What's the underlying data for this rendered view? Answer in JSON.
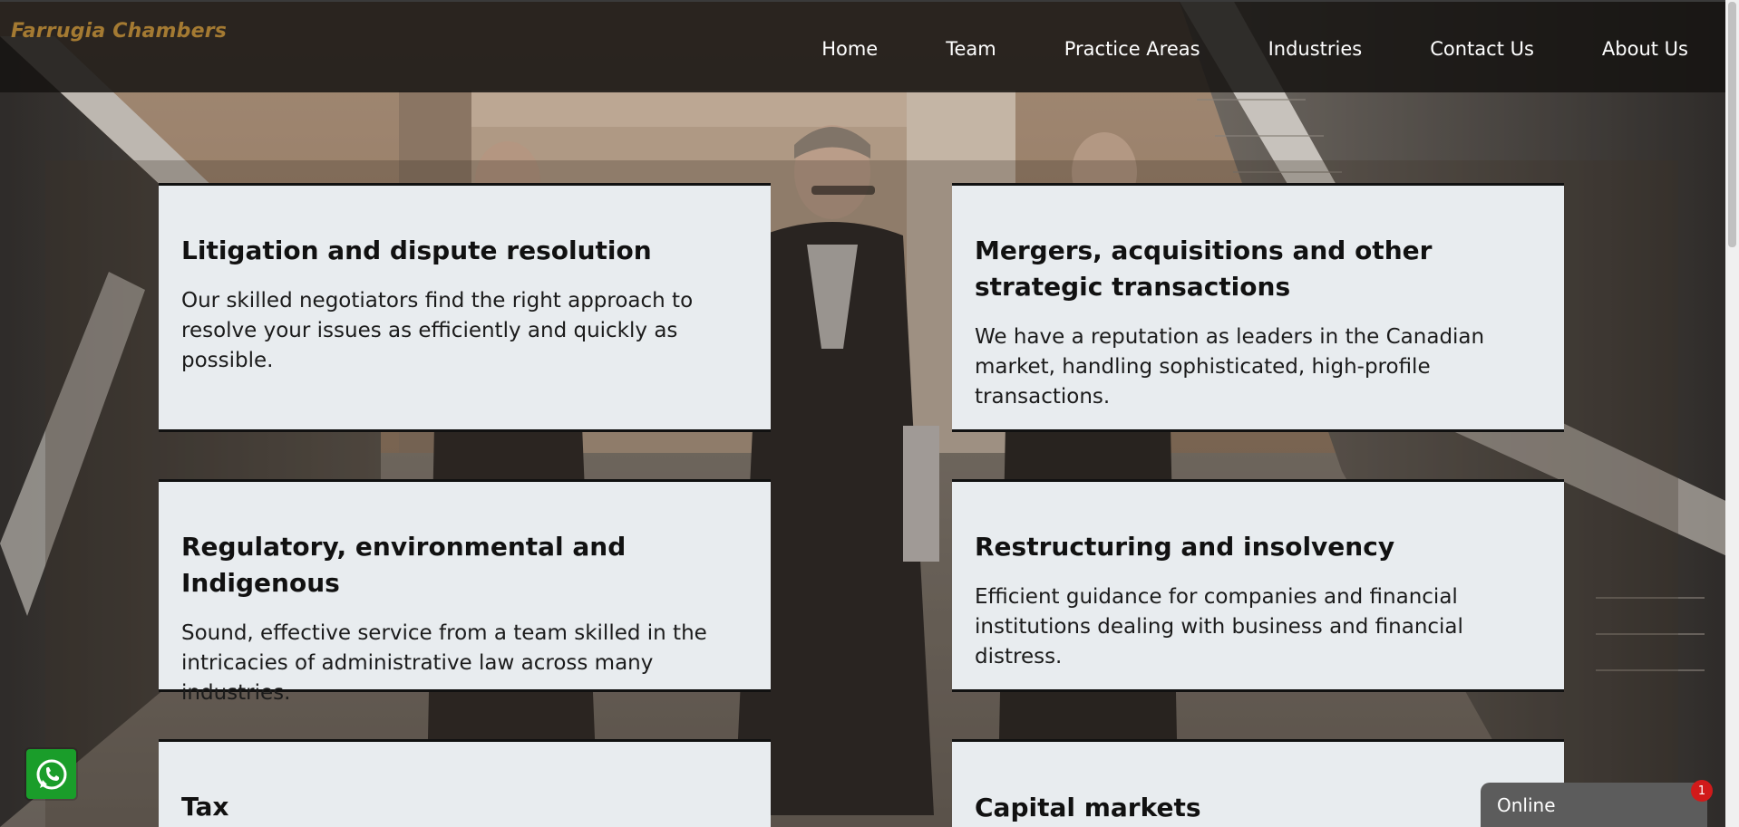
{
  "header": {
    "logo": "Farrugia Chambers",
    "nav": [
      {
        "label": "Home"
      },
      {
        "label": "Team"
      },
      {
        "label": "Practice Areas"
      },
      {
        "label": "Industries"
      },
      {
        "label": "Contact Us"
      },
      {
        "label": "About Us"
      }
    ]
  },
  "practice_areas": [
    {
      "title": "Litigation and dispute resolution",
      "description": "Our skilled negotiators find the right approach to resolve your issues as efficiently and quickly as possible."
    },
    {
      "title": "Mergers, acquisitions and other strategic transactions",
      "description": "We have a reputation as leaders in the Canadian market, handling sophisticated, high-profile transactions."
    },
    {
      "title": "Regulatory, environmental and Indigenous",
      "description": "Sound, effective service from a team skilled in the intricacies of administrative law across many industries."
    },
    {
      "title": "Restructuring and insolvency",
      "description": "Efficient guidance for companies and financial institutions dealing with business and financial distress."
    },
    {
      "title": "Tax",
      "description": ""
    },
    {
      "title": "Capital markets",
      "description": ""
    }
  ],
  "chat_widget": {
    "status": "Online",
    "badge_count": "1"
  },
  "icons": {
    "whatsapp": "whatsapp-icon"
  },
  "colors": {
    "logo": "#a47a32",
    "header_bg": "#161412",
    "card_bg": "#e8ecef",
    "whatsapp": "#1a9d2a",
    "badge": "#d11a1a"
  }
}
